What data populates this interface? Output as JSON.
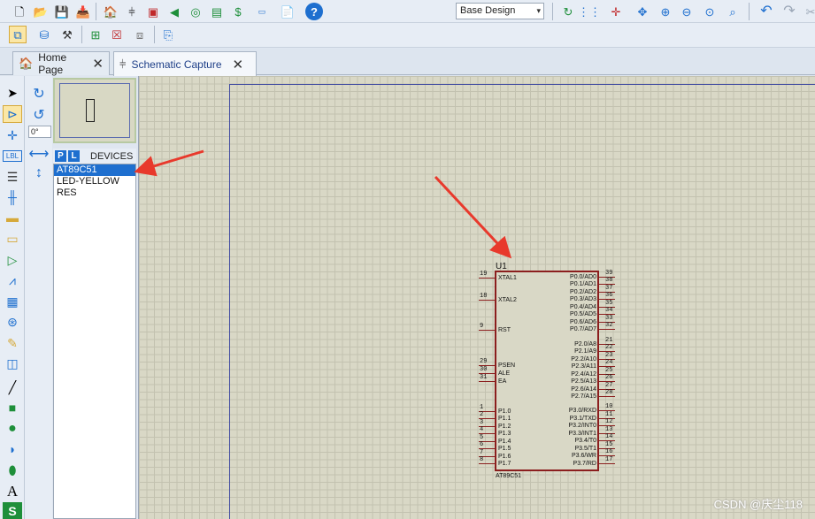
{
  "toolbar": {
    "style_select": "Base Design"
  },
  "tabs": [
    {
      "label": "Home Page"
    },
    {
      "label": "Schematic Capture"
    }
  ],
  "angle": "0°",
  "devices": {
    "p_button": "P",
    "l_button": "L",
    "title": "DEVICES",
    "items": [
      "AT89C51",
      "LED-YELLOW",
      "RES"
    ]
  },
  "component": {
    "ref": "U1",
    "part": "AT89C51",
    "left_pins": [
      {
        "num": "19",
        "label": "XTAL1"
      },
      {
        "num": "18",
        "label": "XTAL2"
      },
      {
        "num": "9",
        "label": "RST"
      },
      {
        "num": "29",
        "label": "PSEN"
      },
      {
        "num": "30",
        "label": "ALE"
      },
      {
        "num": "31",
        "label": "EA"
      },
      {
        "num": "1",
        "label": "P1.0"
      },
      {
        "num": "2",
        "label": "P1.1"
      },
      {
        "num": "3",
        "label": "P1.2"
      },
      {
        "num": "4",
        "label": "P1.3"
      },
      {
        "num": "5",
        "label": "P1.4"
      },
      {
        "num": "6",
        "label": "P1.5"
      },
      {
        "num": "7",
        "label": "P1.6"
      },
      {
        "num": "8",
        "label": "P1.7"
      }
    ],
    "right_pins": [
      {
        "num": "39",
        "label": "P0.0/AD0"
      },
      {
        "num": "38",
        "label": "P0.1/AD1"
      },
      {
        "num": "37",
        "label": "P0.2/AD2"
      },
      {
        "num": "36",
        "label": "P0.3/AD3"
      },
      {
        "num": "35",
        "label": "P0.4/AD4"
      },
      {
        "num": "34",
        "label": "P0.5/AD5"
      },
      {
        "num": "33",
        "label": "P0.6/AD6"
      },
      {
        "num": "32",
        "label": "P0.7/AD7"
      },
      {
        "num": "21",
        "label": "P2.0/A8"
      },
      {
        "num": "22",
        "label": "P2.1/A9"
      },
      {
        "num": "23",
        "label": "P2.2/A10"
      },
      {
        "num": "24",
        "label": "P2.3/A11"
      },
      {
        "num": "25",
        "label": "P2.4/A12"
      },
      {
        "num": "26",
        "label": "P2.5/A13"
      },
      {
        "num": "27",
        "label": "P2.6/A14"
      },
      {
        "num": "28",
        "label": "P2.7/A15"
      },
      {
        "num": "10",
        "label": "P3.0/RXD"
      },
      {
        "num": "11",
        "label": "P3.1/TXD"
      },
      {
        "num": "12",
        "label": "P3.2/INT0"
      },
      {
        "num": "13",
        "label": "P3.3/INT1"
      },
      {
        "num": "14",
        "label": "P3.4/T0"
      },
      {
        "num": "15",
        "label": "P3.5/T1"
      },
      {
        "num": "16",
        "label": "P3.6/WR"
      },
      {
        "num": "17",
        "label": "P3.7/RD"
      }
    ]
  },
  "watermark": "CSDN @庆尘118",
  "colors": {
    "accent": "#1e6fcf",
    "component_outline": "#8b1e1e",
    "arrow": "#e8392c",
    "canvas": "#d9d8c6"
  }
}
